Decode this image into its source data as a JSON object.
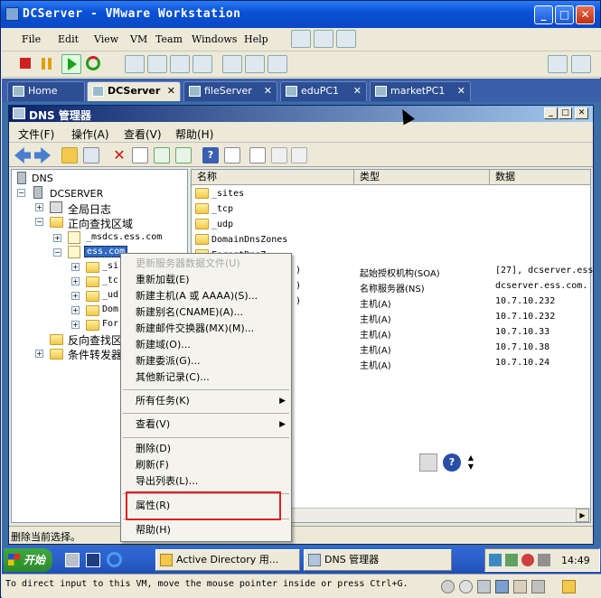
{
  "vmware": {
    "title": "DCServer - VMware Workstation",
    "menu": [
      "File",
      "Edit",
      "View",
      "VM",
      "Team",
      "Windows",
      "Help"
    ],
    "tabs": [
      {
        "label": "Home",
        "active": false
      },
      {
        "label": "DCServer",
        "active": true
      },
      {
        "label": "fileServer",
        "active": false
      },
      {
        "label": "eduPC1",
        "active": false
      },
      {
        "label": "marketPC1",
        "active": false
      }
    ],
    "status_text": "To direct input to this VM, move the mouse pointer inside or press Ctrl+G."
  },
  "dns": {
    "title": "DNS 管理器",
    "menu": [
      "文件(F)",
      "操作(A)",
      "查看(V)",
      "帮助(H)"
    ],
    "tree": {
      "root": "DNS",
      "server": "DCSERVER",
      "global_log": "全局日志",
      "forward": "正向查找区域",
      "msdcs": "_msdcs.ess.com",
      "zone": "ess.com",
      "children": [
        "_si",
        "_tc",
        "_ud",
        "Dom",
        "For"
      ],
      "reverse": "反向查找区",
      "conditional": "条件转发器"
    },
    "list": {
      "columns": [
        "名称",
        "类型",
        "数据"
      ],
      "rows": [
        {
          "name": "_sites",
          "type": "",
          "data": ""
        },
        {
          "name": "_tcp",
          "type": "",
          "data": ""
        },
        {
          "name": "_udp",
          "type": "",
          "data": ""
        },
        {
          "name": "DomainDnsZones",
          "type": "",
          "data": ""
        },
        {
          "name": "ForestDnsZ",
          "type": "",
          "data": ""
        },
        {
          "name": ")",
          "type": "起始授权机构(SOA)",
          "data": "[27], dcserver.ess"
        },
        {
          "name": ")",
          "type": "名称服务器(NS)",
          "data": "dcserver.ess.com."
        },
        {
          "name": ")",
          "type": "主机(A)",
          "data": "10.7.10.232"
        },
        {
          "name": "",
          "type": "主机(A)",
          "data": "10.7.10.232"
        },
        {
          "name": "",
          "type": "主机(A)",
          "data": "10.7.10.33"
        },
        {
          "name": "",
          "type": "主机(A)",
          "data": "10.7.10.38"
        },
        {
          "name": "",
          "type": "主机(A)",
          "data": "10.7.10.24"
        }
      ]
    },
    "status": "删除当前选择。"
  },
  "context_menu": {
    "items": [
      {
        "label": "更新服务器数据文件(U)",
        "disabled": true
      },
      {
        "label": "重新加载(E)"
      },
      {
        "label": "新建主机(A 或 AAAA)(S)..."
      },
      {
        "label": "新建别名(CNAME)(A)..."
      },
      {
        "label": "新建邮件交换器(MX)(M)..."
      },
      {
        "label": "新建域(O)..."
      },
      {
        "label": "新建委派(G)..."
      },
      {
        "label": "其他新记录(C)..."
      },
      {
        "label": "所有任务(K)",
        "submenu": true
      },
      {
        "label": "查看(V)",
        "submenu": true
      },
      {
        "label": "删除(D)"
      },
      {
        "label": "刷新(F)"
      },
      {
        "label": "导出列表(L)..."
      },
      {
        "label": "属性(R)"
      },
      {
        "label": "帮助(H)"
      }
    ]
  },
  "taskbar": {
    "start": "开始",
    "tasks": [
      "Active Directory 用...",
      "DNS 管理器"
    ],
    "clock": "14:49"
  },
  "colors": {
    "title_blue": "#0a52d6",
    "highlight_red": "#e02020",
    "taskbar_blue": "#2a5fc9"
  }
}
